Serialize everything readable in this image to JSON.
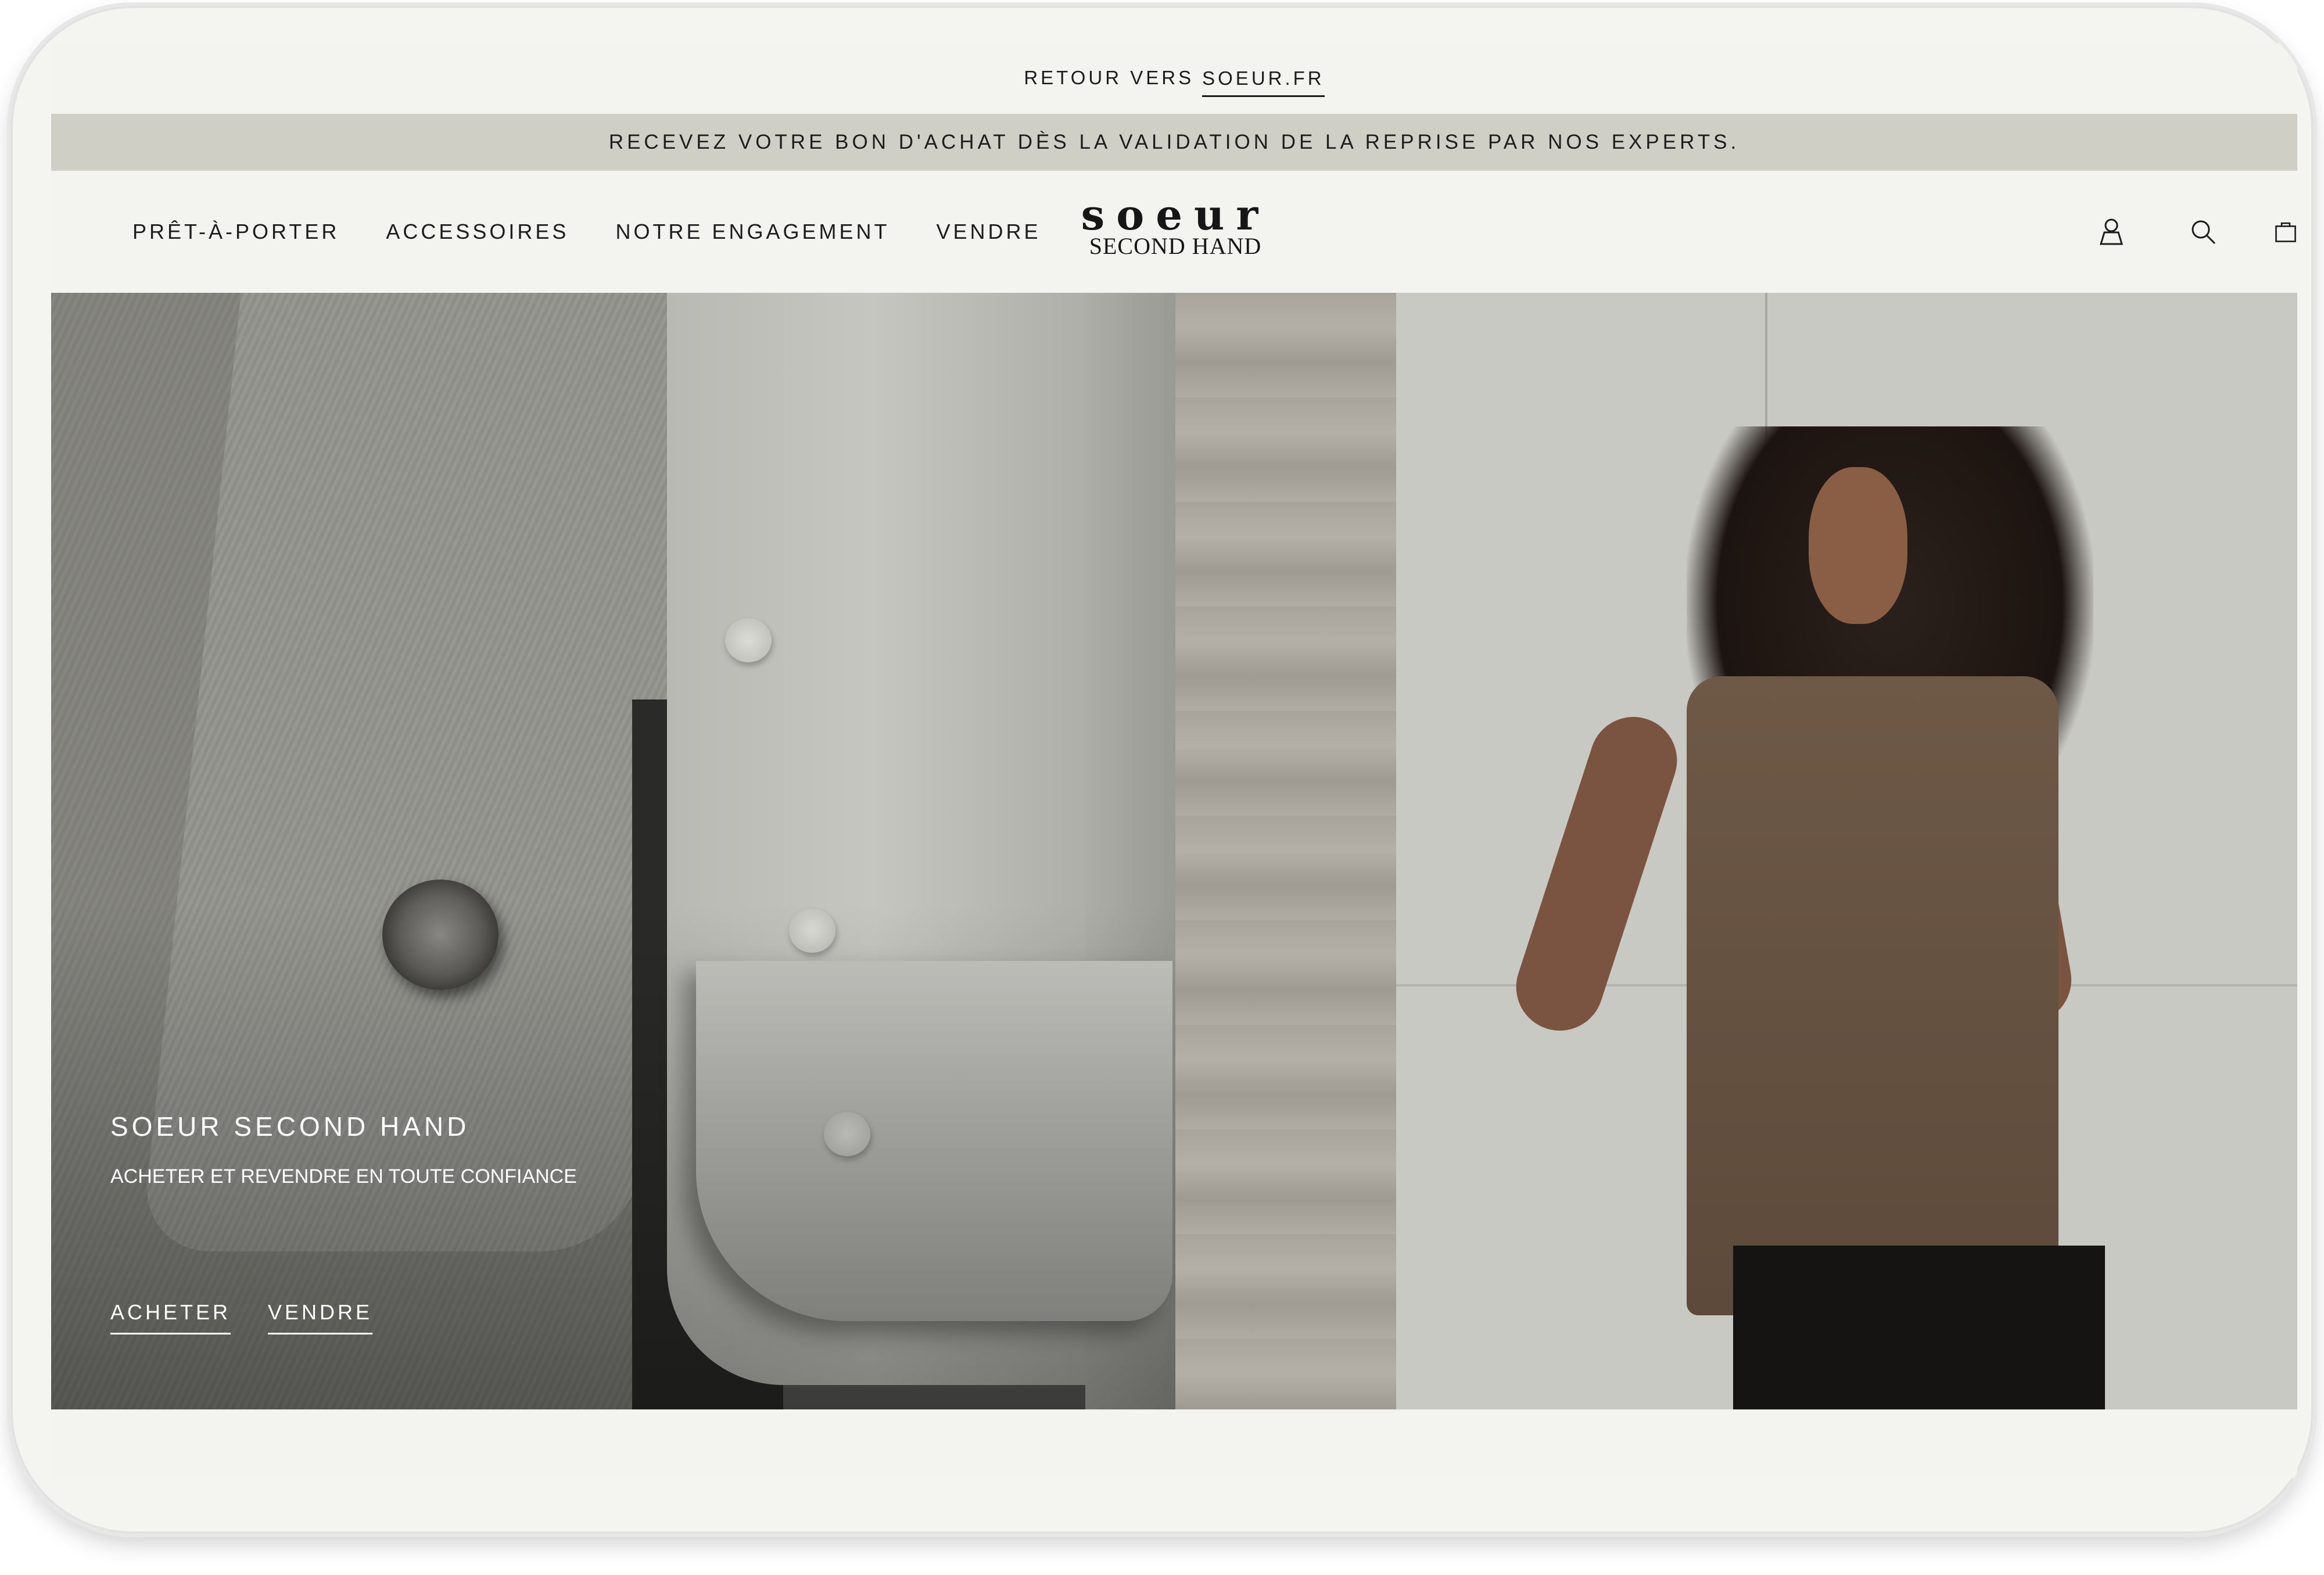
{
  "top_bar": {
    "prefix": "RETOUR VERS",
    "link": "SOEUR.FR"
  },
  "promo": {
    "text": "RECEVEZ VOTRE BON D'ACHAT DÈS LA VALIDATION DE LA REPRISE PAR NOS EXPERTS."
  },
  "nav": {
    "items": [
      {
        "label": "PRÊT-À-PORTER"
      },
      {
        "label": "ACCESSOIRES"
      },
      {
        "label": "NOTRE ENGAGEMENT"
      },
      {
        "label": "VENDRE"
      }
    ]
  },
  "logo": {
    "line1": "soeur",
    "line2": "SECOND HAND"
  },
  "header_icons": [
    "account-icon",
    "search-icon",
    "shopping-bag-icon"
  ],
  "hero": {
    "title": "SOEUR SECOND HAND",
    "subtitle": "ACHETER ET REVENDRE EN TOUTE CONFIANCE",
    "cta_buy": "ACHETER",
    "cta_sell": "VENDRE"
  },
  "colors": {
    "page_bg": "#f3f3ef",
    "promo_bg": "#cfcfc6",
    "text": "#1c1c1c"
  }
}
